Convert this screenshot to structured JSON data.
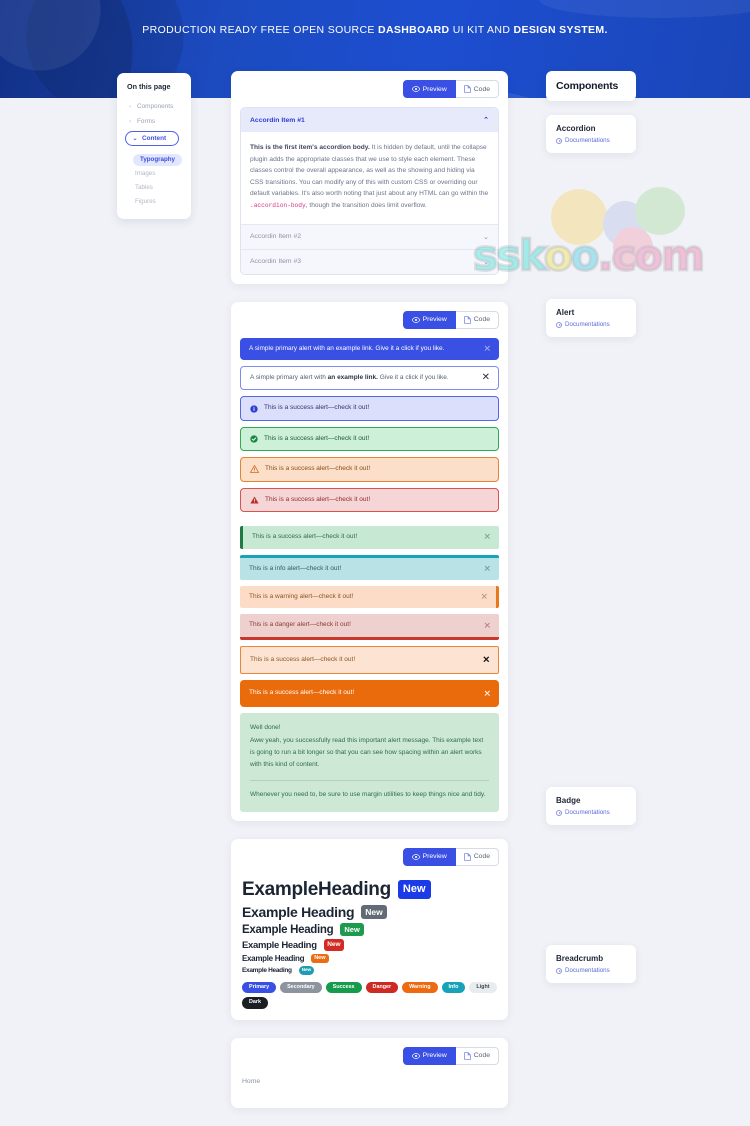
{
  "banner": {
    "text_plain_1": "PRODUCTION READY FREE OPEN SOURCE ",
    "text_bold_1": "DASHBOARD",
    "text_plain_2": " UI KIT AND ",
    "text_bold_2": "DESIGN SYSTEM."
  },
  "toc": {
    "title": "On this page",
    "items": [
      {
        "label": "Components",
        "icon": "chevron-right-icon"
      },
      {
        "label": "Forms",
        "icon": "chevron-right-icon"
      },
      {
        "label": "Content",
        "icon": "chevron-down-icon"
      }
    ],
    "sub_items": [
      {
        "label": "Typography",
        "active": true
      },
      {
        "label": "Images",
        "active": false
      },
      {
        "label": "Tables",
        "active": false
      },
      {
        "label": "Figures",
        "active": false
      }
    ]
  },
  "buttons": {
    "preview": "Preview",
    "code": "Code"
  },
  "accordion": {
    "items": [
      {
        "title": "Accordin Item #1",
        "open": true
      },
      {
        "title": "Accordin Item #2",
        "open": false
      },
      {
        "title": "Accordin Item #3",
        "open": false
      }
    ],
    "body_lead": "This is the first item's accordion body.",
    "body_rest": " It is hidden by default, until the collapse plugin adds the appropriate classes that we use to style each element. These classes control the overall appearance, as well as the showing and hiding via CSS transitions. You can modify any of this with custom CSS or overriding our default variables. It's also worth noting that just about any HTML can go within the ",
    "body_code": ".accordion-body",
    "body_tail": ", though the transition does limit overflow."
  },
  "alerts": {
    "primary_solid": {
      "text": "A simple primary alert with an example link. Give it a click if you like."
    },
    "primary_outline": {
      "pre": "A simple primary alert with ",
      "link": "an example link.",
      "post": " Give it a click if you like."
    },
    "icon_rows": [
      {
        "text": "This is a success alert—check it out!",
        "icon": "info-circle-icon",
        "style": "alert-info-soft"
      },
      {
        "text": "This is a success alert—check it out!",
        "icon": "check-circle-icon",
        "style": "alert-success-soft"
      },
      {
        "text": "This is a success alert—check it out!",
        "icon": "warning-triangle-icon",
        "style": "alert-warning-soft"
      },
      {
        "text": "This is a success alert—check it out!",
        "icon": "danger-triangle-icon",
        "style": "alert-danger-soft"
      }
    ],
    "bar_rows": [
      {
        "text": "This is a success alert—check it out!",
        "style": "bar-left-success"
      },
      {
        "text": "This is a info alert—check it out!",
        "style": "bar-top-info"
      },
      {
        "text": "This is a warning alert—check it out!",
        "style": "bar-right-warning"
      },
      {
        "text": "This is a danger alert—check it out!",
        "style": "bar-bottom-danger"
      },
      {
        "text": "This is a success alert—check it out!",
        "style": "bar-all-warning"
      },
      {
        "text": "This is a success alert—check it out!",
        "style": "alert-solid-orange"
      }
    ],
    "block": {
      "heading": "Well done!",
      "paragraph": "Aww yeah, you successfully read this important alert message. This example text is going to run a bit longer so that you can see how spacing within an alert works with this kind of content.",
      "footer": "Whenever you need to, be sure to use margin utilities to keep things nice and tidy."
    },
    "close_icon": "close-icon"
  },
  "badges": {
    "headings": [
      {
        "text": "ExampleHeading",
        "badge": "New",
        "color": "#1b3ae8",
        "rounded": false
      },
      {
        "text": "Example Heading",
        "badge": "New",
        "color": "#636c76",
        "rounded": false
      },
      {
        "text": "Example Heading",
        "badge": "New",
        "color": "#1d9a4d",
        "rounded": false
      },
      {
        "text": "Example Heading",
        "badge": "New",
        "color": "#d32a24",
        "rounded": false
      },
      {
        "text": "Example Heading",
        "badge": "New",
        "color": "#ec6c13",
        "rounded": false
      },
      {
        "text": "Example Heading",
        "badge": "New",
        "color": "#1f9bb3",
        "rounded": true
      }
    ],
    "pills": [
      {
        "label": "Primary",
        "color": "#3a50e4",
        "text_color": "#ffffff"
      },
      {
        "label": "Secondary",
        "color": "#8d949e",
        "text_color": "#ffffff"
      },
      {
        "label": "Success",
        "color": "#169b4d",
        "text_color": "#ffffff"
      },
      {
        "label": "Danger",
        "color": "#cc2a22",
        "text_color": "#ffffff"
      },
      {
        "label": "Warning",
        "color": "#ee6a11",
        "text_color": "#ffffff"
      },
      {
        "label": "Info",
        "color": "#17a2b8",
        "text_color": "#ffffff"
      },
      {
        "label": "Light",
        "color": "#e9ecef",
        "text_color": "#41484f"
      },
      {
        "label": "Dark",
        "color": "#1b1f24",
        "text_color": "#ffffff"
      }
    ]
  },
  "breadcrumb": {
    "home": "Home"
  },
  "components_panel": {
    "title": "Components",
    "doc_label": "Documentations",
    "cards": [
      {
        "name": "Accordion"
      },
      {
        "name": "Alert"
      },
      {
        "name": "Badge"
      },
      {
        "name": "Breadcrumb"
      }
    ]
  },
  "watermark": {
    "text": "sskoo.com"
  },
  "colors": {
    "brand_blue": "#3a50e4",
    "banner_blue": "#1d4ed0",
    "page_bg": "#f1f2f7"
  }
}
